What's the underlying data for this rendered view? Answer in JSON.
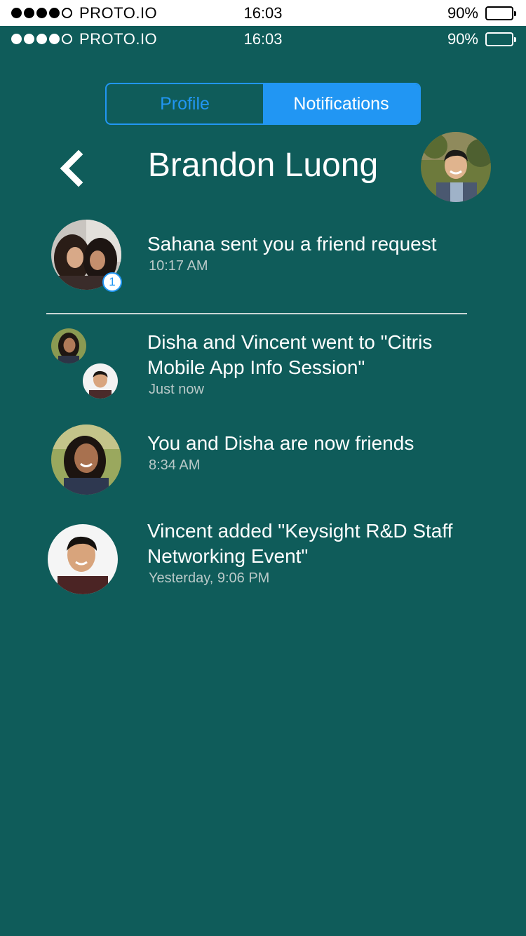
{
  "status_bar_top": {
    "carrier": "PROTO.IO",
    "time": "16:03",
    "battery": "90%"
  },
  "status_bar_app": {
    "carrier": "PROTO.IO",
    "time": "16:03",
    "battery": "90%"
  },
  "battery_level": 0.9,
  "tabs": [
    {
      "label": "Profile",
      "active": false
    },
    {
      "label": "Notifications",
      "active": true
    }
  ],
  "header": {
    "title": "Brandon Luong"
  },
  "notifications": [
    {
      "text": "Sahana sent you a friend request",
      "time": "10:17 AM",
      "badge": "1",
      "avatar": "two-friends-photo"
    },
    {
      "text": "Disha and Vincent went to \"Citris Mobile App Info Session\"",
      "time": "Just now",
      "avatar": "two-small-photos"
    },
    {
      "text": "You and Disha are now friends",
      "time": "8:34 AM",
      "avatar": "disha-photo"
    },
    {
      "text": "Vincent added \"Keysight R&D Staff Networking Event\"",
      "time": "Yesterday, 9:06 PM",
      "avatar": "vincent-photo"
    }
  ],
  "colors": {
    "background": "#0f5c5a",
    "accent": "#2196f3",
    "secondary_text": "#b9c9c8"
  }
}
